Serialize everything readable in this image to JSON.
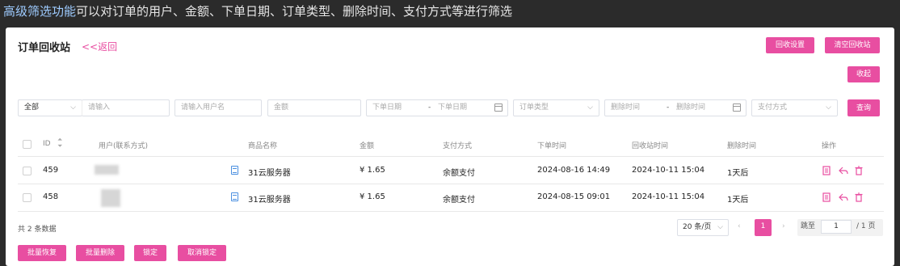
{
  "caption": {
    "highlight": "高级筛选功能",
    "rest": "可以对订单的用户、金额、下单日期、订单类型、删除时间、支付方式等进行筛选"
  },
  "header": {
    "title": "订单回收站",
    "back": "<<返回",
    "recycle_settings": "回收设置",
    "clear_recycle": "清空回收站",
    "collapse": "收起"
  },
  "filters": {
    "scope_selected": "全部",
    "keyword_placeholder": "请输入",
    "username_placeholder": "请输入用户名",
    "amount_placeholder": "金额",
    "order_date_start": "下单日期",
    "order_date_sep": "-",
    "order_date_end": "下单日期",
    "order_type_placeholder": "订单类型",
    "delete_time_start": "删除时间",
    "delete_time_sep": "-",
    "delete_time_end": "删除时间",
    "pay_method_placeholder": "支付方式",
    "query": "查询"
  },
  "table": {
    "columns": [
      "ID",
      "用户(联系方式)",
      "商品名称",
      "金额",
      "支付方式",
      "下单时间",
      "回收站时间",
      "删除时间",
      "操作"
    ],
    "rows": [
      {
        "id": "459",
        "product": "31云服务器",
        "amount": "¥ 1.65",
        "pay": "余额支付",
        "order_time": "2024-08-16 14:49",
        "recycle_time": "2024-10-11 15:04",
        "delete_time": "1天后"
      },
      {
        "id": "458",
        "product": "31云服务器",
        "amount": "¥ 1.65",
        "pay": "余额支付",
        "order_time": "2024-08-15 09:01",
        "recycle_time": "2024-10-11 15:04",
        "delete_time": "1天后"
      }
    ]
  },
  "footer": {
    "total": "共 2 条数据",
    "page_size": "20 条/页",
    "current_page": "1",
    "goto_label": "跳至",
    "goto_value": "1",
    "total_pages": "/ 1 页"
  },
  "batch": {
    "restore": "批量恢复",
    "delete": "批量删除",
    "lock": "锁定",
    "unlock": "取消锁定"
  },
  "colors": {
    "accent": "#e84ea1",
    "link_blue": "#4a8fe0",
    "caption_highlight": "#9ecbff"
  },
  "icons": [
    "sort-icon",
    "chevron-down-icon",
    "calendar-icon",
    "document-icon",
    "detail-icon",
    "restore-icon",
    "trash-icon",
    "chevron-left-icon",
    "chevron-right-icon"
  ]
}
